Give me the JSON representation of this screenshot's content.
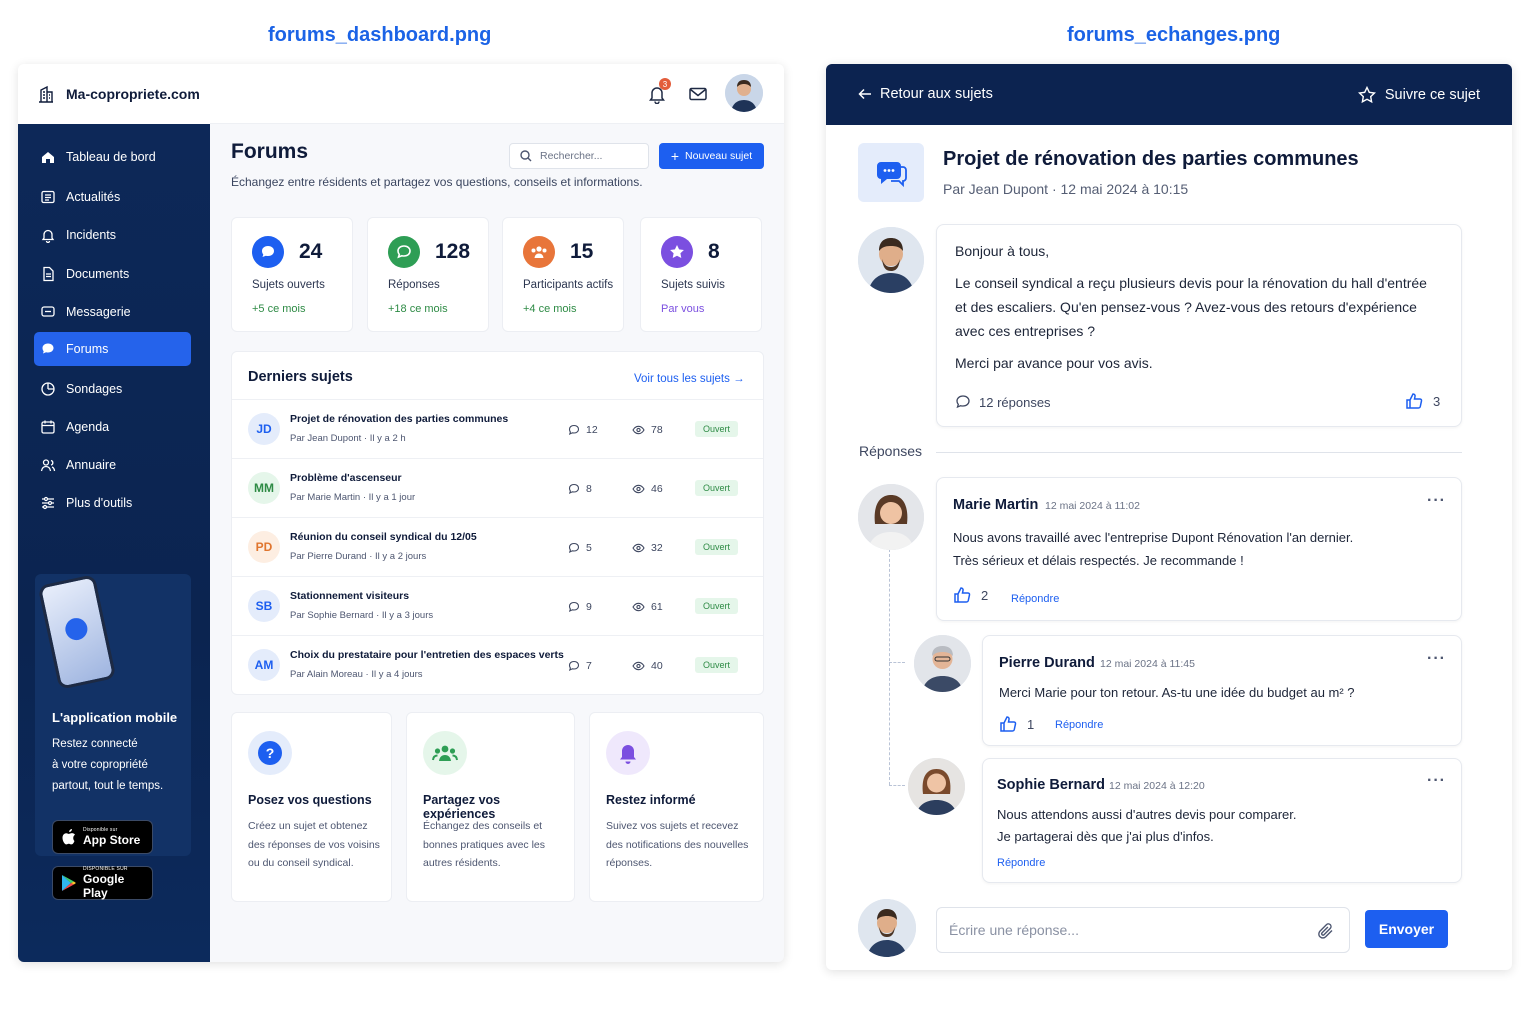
{
  "captions": {
    "left": "forums_dashboard.png",
    "right": "forums_echanges.png"
  },
  "dashboard": {
    "brand": "Ma-copropriete.com",
    "nav": [
      {
        "label": "Tableau de bord",
        "icon": "home-icon"
      },
      {
        "label": "Actualités",
        "icon": "news-icon"
      },
      {
        "label": "Incidents",
        "icon": "bell-icon"
      },
      {
        "label": "Documents",
        "icon": "document-icon"
      },
      {
        "label": "Messagerie",
        "icon": "message-icon"
      },
      {
        "label": "Forums",
        "icon": "forum-icon",
        "active": true
      },
      {
        "label": "Sondages",
        "icon": "poll-icon"
      },
      {
        "label": "Agenda",
        "icon": "calendar-icon"
      },
      {
        "label": "Annuaire",
        "icon": "directory-icon"
      },
      {
        "label": "Plus d'outils",
        "icon": "tools-icon"
      }
    ],
    "promo": {
      "title": "L'application mobile",
      "lines": [
        "Restez connecté",
        "à votre copropriété",
        "partout, tout le temps."
      ],
      "app_store": {
        "small": "Disponible sur",
        "big": "App Store"
      },
      "google_play": {
        "small": "DISPONIBLE SUR",
        "big": "Google Play"
      }
    },
    "notif_count": "3",
    "title": "Forums",
    "subtitle": "Échangez entre résidents et partagez vos questions, conseils et informations.",
    "search_placeholder": "Rechercher...",
    "new_button": "Nouveau sujet",
    "stats": [
      {
        "value": "24",
        "label": "Sujets ouverts",
        "sub": "+5 ce mois",
        "color": "#1d5ff0",
        "sub_color": "#2e8b45"
      },
      {
        "value": "128",
        "label": "Réponses",
        "sub": "+18 ce mois",
        "color": "#2e9e55",
        "sub_color": "#2e8b45"
      },
      {
        "value": "15",
        "label": "Participants actifs",
        "sub": "+4 ce mois",
        "color": "#e8753a",
        "sub_color": "#2e8b45"
      },
      {
        "value": "8",
        "label": "Sujets suivis",
        "sub": "Par vous",
        "color": "#7b4fe0",
        "sub_color": "#7b4fe0"
      }
    ],
    "latest": {
      "title": "Derniers sujets",
      "see_all": "Voir tous les sujets",
      "rows": [
        {
          "initials": "JD",
          "title": "Projet de rénovation des parties communes",
          "author": "Par Jean Dupont",
          "time": "Il y a 2 h",
          "comments": "12",
          "views": "78",
          "status": "Ouvert",
          "fg": "#1d5ff0",
          "bg": "#e4ecfb"
        },
        {
          "initials": "MM",
          "title": "Problème d'ascenseur",
          "author": "Par Marie Martin",
          "time": "Il y a 1 jour",
          "comments": "8",
          "views": "46",
          "status": "Ouvert",
          "fg": "#2e8b45",
          "bg": "#e5f6ea"
        },
        {
          "initials": "PD",
          "title": "Réunion du conseil syndical du 12/05",
          "author": "Par Pierre Durand",
          "time": "Il y a 2 jours",
          "comments": "5",
          "views": "32",
          "status": "Ouvert",
          "fg": "#e0752e",
          "bg": "#fdeee2"
        },
        {
          "initials": "SB",
          "title": "Stationnement visiteurs",
          "author": "Par Sophie Bernard",
          "time": "Il y a 3 jours",
          "comments": "9",
          "views": "61",
          "status": "Ouvert",
          "fg": "#1d5ff0",
          "bg": "#e4ecfb"
        },
        {
          "initials": "AM",
          "title": "Choix du prestataire pour l'entretien des espaces verts",
          "author": "Par Alain Moreau",
          "time": "Il y a 4 jours",
          "comments": "7",
          "views": "40",
          "status": "Ouvert",
          "fg": "#1d5ff0",
          "bg": "#e4ecfb"
        }
      ]
    },
    "info": [
      {
        "title": "Posez vos questions",
        "lines": [
          "Créez un sujet et obtenez",
          "des réponses de vos voisins",
          "ou du conseil syndical."
        ],
        "icon": "question-icon"
      },
      {
        "title": "Partagez vos expériences",
        "lines": [
          "Échangez des conseils et",
          "bonnes pratiques avec les",
          "autres résidents."
        ],
        "icon": "group-icon"
      },
      {
        "title": "Restez informé",
        "lines": [
          "Suivez vos sujets et recevez",
          "des notifications des nouvelles",
          "réponses."
        ],
        "icon": "notification-icon"
      }
    ]
  },
  "thread": {
    "back": "Retour aux sujets",
    "follow": "Suivre ce sujet",
    "title": "Projet de rénovation des parties communes",
    "meta": "Par Jean Dupont  ·  12 mai 2024 à 10:15",
    "post": {
      "greeting": "Bonjour à tous,",
      "body": [
        "Le conseil syndical a reçu plusieurs devis pour la rénovation du hall d'entrée",
        "et des escaliers. Qu'en pensez-vous ? Avez-vous des retours d'expérience",
        "avec ces entreprises ?"
      ],
      "closing": "Merci par avance pour vos avis.",
      "replies_count": "12 réponses",
      "likes": "3"
    },
    "replies_label": "Réponses",
    "replies": [
      {
        "author": "Marie Martin",
        "date": "12 mai 2024 à 11:02",
        "lines": [
          "Nous avons travaillé avec l'entreprise Dupont Rénovation l'an dernier.",
          "Très sérieux et délais respectés. Je recommande !"
        ],
        "likes": "2",
        "reply": "Répondre"
      },
      {
        "author": "Pierre Durand",
        "date": "12 mai 2024 à 11:45",
        "lines": [
          "Merci Marie pour ton retour. As-tu une idée du budget au m² ?"
        ],
        "likes": "1",
        "reply": "Répondre"
      },
      {
        "author": "Sophie Bernard",
        "date": "12 mai 2024 à 12:20",
        "lines": [
          "Nous attendons aussi d'autres devis pour comparer.",
          "Je partagerai dès que j'ai plus d'infos."
        ],
        "reply": "Répondre"
      }
    ],
    "composer_placeholder": "Écrire une réponse...",
    "send": "Envoyer"
  }
}
